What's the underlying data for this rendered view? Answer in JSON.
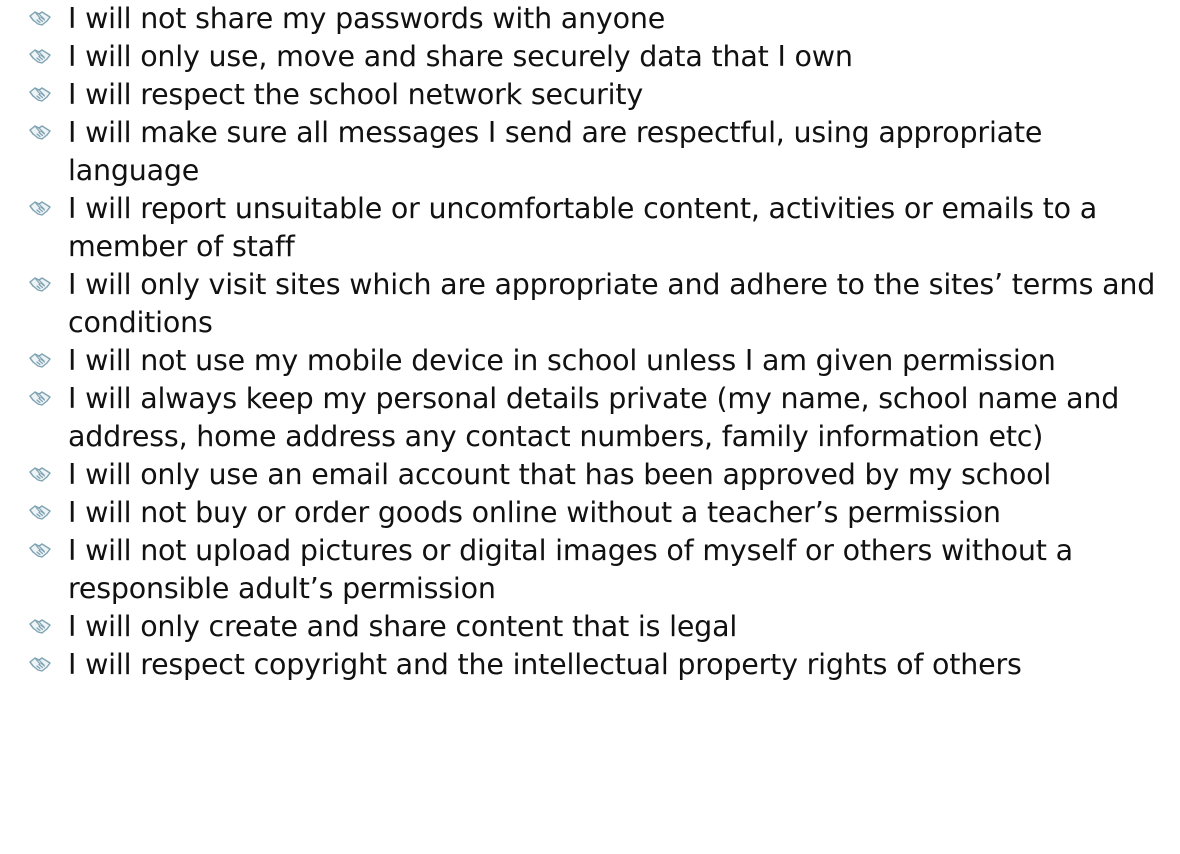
{
  "bullet_icon": "handshake-icon",
  "bullet_color": "#7fa3b3",
  "rules": [
    "I will not share my passwords with anyone",
    "I will only use, move and share securely data that I own",
    "I will respect the school network security",
    "I will make sure all messages I send are respectful, using appropriate language",
    "I will report unsuitable or uncomfortable content, activities or emails to a member of staff",
    "I will only visit sites which are appropriate and adhere to the sites’ terms and conditions",
    "I will not use my mobile device in school unless I am given permission",
    "I will always keep my personal details private (my name, school name and address, home address any contact numbers, family information etc)",
    "I will only use an email account that has been approved by my school",
    "I will not buy or order goods online without a teacher’s permission",
    "I will not upload pictures or digital images of myself or others without a responsible adult’s permission",
    "I will only create and share content that is legal",
    "I will respect copyright and the intellectual property rights of others"
  ]
}
